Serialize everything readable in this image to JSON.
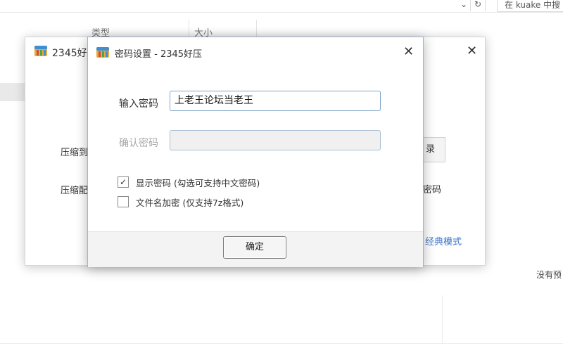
{
  "explorer": {
    "search_text": "在 kuake 中搜",
    "col_type": "类型",
    "col_size": "大小",
    "bottom_text": "没有预",
    "chevron_icon": "chevron-down-icon",
    "refresh_icon": "refresh-icon"
  },
  "parent_window": {
    "title": "2345好压",
    "label_1": "压缩到",
    "label_2": "压缩配",
    "button_partial": "录",
    "right_text": "密码",
    "link_text": "经典模式",
    "close_symbol": "✕"
  },
  "dialog": {
    "title": "密码设置 - 2345好压",
    "close_symbol": "✕",
    "password_label": "输入密码",
    "password_value": "上老王论坛当老王",
    "confirm_label": "确认密码",
    "confirm_value": "",
    "show_password_checked": true,
    "show_password_label": "显示密码 (勾选可支持中文密码)",
    "encrypt_filenames_checked": false,
    "encrypt_filenames_label": "文件名加密 (仅支持7z格式)",
    "ok_label": "确定",
    "check_mark": "✓"
  },
  "colors": {
    "accent_link": "#3a73c8",
    "input_border": "#7fa3c8"
  }
}
